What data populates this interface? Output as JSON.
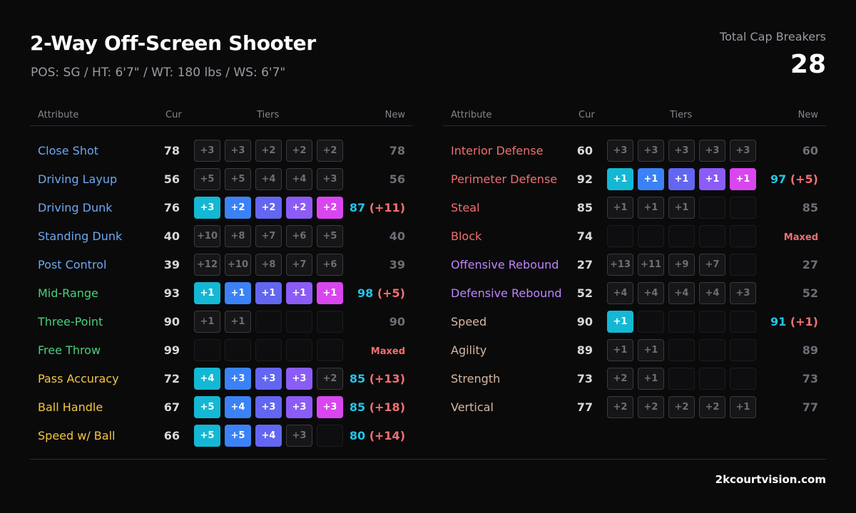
{
  "header": {
    "title": "2-Way Off-Screen Shooter",
    "subtitle": "POS: SG / HT: 6'7\" / WT: 180 lbs / WS: 6'7\"",
    "cap_label": "Total Cap Breakers",
    "cap_value": "28"
  },
  "columns": {
    "attribute": "Attribute",
    "cur": "Cur",
    "tiers": "Tiers",
    "new": "New"
  },
  "colors": {
    "finishing": "#6ea8f0",
    "shooting": "#4ad07a",
    "playmaking": "#f5c542",
    "defense": "#f07070",
    "rebounding": "#c084fc",
    "physical": "#d8b8a0",
    "tier_fills": [
      "#14b8d4",
      "#3b82f6",
      "#6366f1",
      "#8b5cf6",
      "#d946ef"
    ]
  },
  "left_table": [
    {
      "name": "Close Shot",
      "group": "finishing",
      "cur": "78",
      "tiers": [
        "+3",
        "+3",
        "+2",
        "+2",
        "+2"
      ],
      "filled": 0,
      "new": "78",
      "delta": ""
    },
    {
      "name": "Driving Layup",
      "group": "finishing",
      "cur": "56",
      "tiers": [
        "+5",
        "+5",
        "+4",
        "+4",
        "+3"
      ],
      "filled": 0,
      "new": "56",
      "delta": ""
    },
    {
      "name": "Driving Dunk",
      "group": "finishing",
      "cur": "76",
      "tiers": [
        "+3",
        "+2",
        "+2",
        "+2",
        "+2"
      ],
      "filled": 5,
      "new": "87",
      "delta": "(+11)"
    },
    {
      "name": "Standing Dunk",
      "group": "finishing",
      "cur": "40",
      "tiers": [
        "+10",
        "+8",
        "+7",
        "+6",
        "+5"
      ],
      "filled": 0,
      "new": "40",
      "delta": ""
    },
    {
      "name": "Post Control",
      "group": "finishing",
      "cur": "39",
      "tiers": [
        "+12",
        "+10",
        "+8",
        "+7",
        "+6"
      ],
      "filled": 0,
      "new": "39",
      "delta": ""
    },
    {
      "name": "Mid-Range",
      "group": "shooting",
      "cur": "93",
      "tiers": [
        "+1",
        "+1",
        "+1",
        "+1",
        "+1"
      ],
      "filled": 5,
      "new": "98",
      "delta": "(+5)"
    },
    {
      "name": "Three-Point",
      "group": "shooting",
      "cur": "90",
      "tiers": [
        "+1",
        "+1",
        "",
        "",
        ""
      ],
      "filled": 0,
      "new": "90",
      "delta": ""
    },
    {
      "name": "Free Throw",
      "group": "shooting",
      "cur": "99",
      "tiers": [
        "",
        "",
        "",
        "",
        ""
      ],
      "filled": 0,
      "new": "",
      "delta": "",
      "maxed": "Maxed"
    },
    {
      "name": "Pass Accuracy",
      "group": "playmaking",
      "cur": "72",
      "tiers": [
        "+4",
        "+3",
        "+3",
        "+3",
        "+2"
      ],
      "filled": 4,
      "new": "85",
      "delta": "(+13)"
    },
    {
      "name": "Ball Handle",
      "group": "playmaking",
      "cur": "67",
      "tiers": [
        "+5",
        "+4",
        "+3",
        "+3",
        "+3"
      ],
      "filled": 5,
      "new": "85",
      "delta": "(+18)"
    },
    {
      "name": "Speed w/ Ball",
      "group": "playmaking",
      "cur": "66",
      "tiers": [
        "+5",
        "+5",
        "+4",
        "+3",
        ""
      ],
      "filled": 3,
      "new": "80",
      "delta": "(+14)"
    }
  ],
  "right_table": [
    {
      "name": "Interior Defense",
      "group": "defense",
      "cur": "60",
      "tiers": [
        "+3",
        "+3",
        "+3",
        "+3",
        "+3"
      ],
      "filled": 0,
      "new": "60",
      "delta": ""
    },
    {
      "name": "Perimeter Defense",
      "group": "defense",
      "cur": "92",
      "tiers": [
        "+1",
        "+1",
        "+1",
        "+1",
        "+1"
      ],
      "filled": 5,
      "new": "97",
      "delta": "(+5)"
    },
    {
      "name": "Steal",
      "group": "defense",
      "cur": "85",
      "tiers": [
        "+1",
        "+1",
        "+1",
        "",
        ""
      ],
      "filled": 0,
      "new": "85",
      "delta": ""
    },
    {
      "name": "Block",
      "group": "defense",
      "cur": "74",
      "tiers": [
        "",
        "",
        "",
        "",
        ""
      ],
      "filled": 0,
      "new": "",
      "delta": "",
      "maxed": "Maxed"
    },
    {
      "name": "Offensive Rebound",
      "group": "rebounding",
      "cur": "27",
      "tiers": [
        "+13",
        "+11",
        "+9",
        "+7",
        ""
      ],
      "filled": 0,
      "new": "27",
      "delta": ""
    },
    {
      "name": "Defensive Rebound",
      "group": "rebounding",
      "cur": "52",
      "tiers": [
        "+4",
        "+4",
        "+4",
        "+4",
        "+3"
      ],
      "filled": 0,
      "new": "52",
      "delta": ""
    },
    {
      "name": "Speed",
      "group": "physical",
      "cur": "90",
      "tiers": [
        "+1",
        "",
        "",
        "",
        ""
      ],
      "filled": 1,
      "new": "91",
      "delta": "(+1)"
    },
    {
      "name": "Agility",
      "group": "physical",
      "cur": "89",
      "tiers": [
        "+1",
        "+1",
        "",
        "",
        ""
      ],
      "filled": 0,
      "new": "89",
      "delta": ""
    },
    {
      "name": "Strength",
      "group": "physical",
      "cur": "73",
      "tiers": [
        "+2",
        "+1",
        "",
        "",
        ""
      ],
      "filled": 0,
      "new": "73",
      "delta": ""
    },
    {
      "name": "Vertical",
      "group": "physical",
      "cur": "77",
      "tiers": [
        "+2",
        "+2",
        "+2",
        "+2",
        "+1"
      ],
      "filled": 0,
      "new": "77",
      "delta": ""
    }
  ],
  "footer": {
    "site": "2kcourtvision.com"
  }
}
